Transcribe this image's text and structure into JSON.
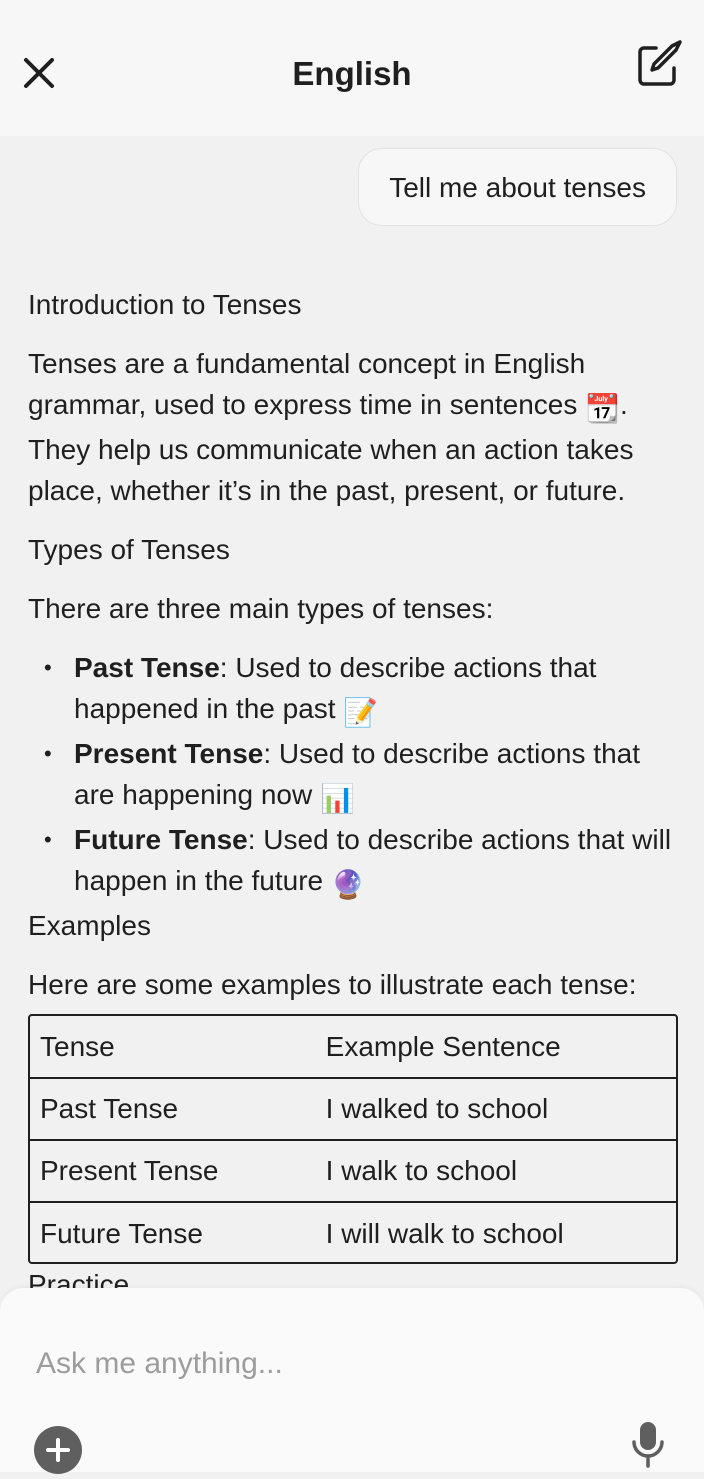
{
  "header": {
    "title": "English",
    "close_icon": "close-icon",
    "compose_icon": "compose-icon"
  },
  "user_message": "Tell me about tenses",
  "response": {
    "intro_heading": "Introduction to Tenses",
    "intro_text_1": "Tenses are a fundamental concept in English grammar, used to express time in sentences",
    "intro_text_2": ". They help us communicate when an action takes place, whether it’s in the past, present, or future.",
    "types_heading": "Types of Tenses",
    "types_intro": "There are three main types of tenses:",
    "types": [
      {
        "name": "Past Tense",
        "desc": ": Used to describe actions that happened in the past",
        "emoji": "📝"
      },
      {
        "name": "Present Tense",
        "desc": ": Used to describe actions that are happening now",
        "emoji": "📊"
      },
      {
        "name": "Future Tense",
        "desc": ": Used to describe actions that will happen in the future",
        "emoji": "🔮"
      }
    ],
    "calendar_emoji": "📆",
    "examples_heading": "Examples",
    "examples_intro": "Here are some examples to illustrate each tense:",
    "table": {
      "headers": [
        "Tense",
        "Example Sentence"
      ],
      "rows": [
        [
          "Past Tense",
          "I walked to school"
        ],
        [
          "Present Tense",
          "I walk to school"
        ],
        [
          "Future Tense",
          "I will walk to school"
        ]
      ]
    },
    "practice_heading": "Practice"
  },
  "composer": {
    "placeholder": "Ask me anything...",
    "add_icon": "plus-icon",
    "mic_icon": "microphone-icon"
  },
  "colors": {
    "background": "#f1f1f1",
    "text": "#1f1f1f",
    "placeholder": "#9c9c9c",
    "add_button": "#5f5f5f"
  }
}
